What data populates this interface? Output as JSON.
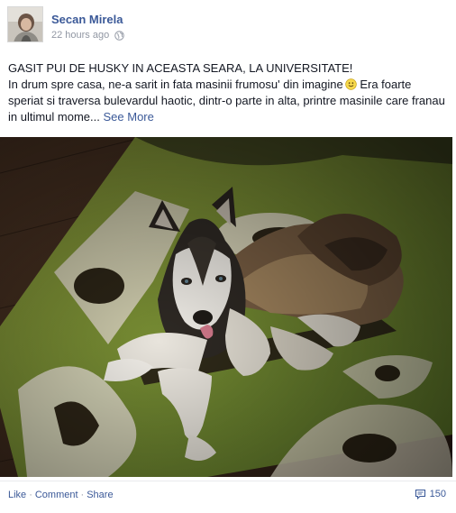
{
  "post": {
    "author": "Secan Mirela",
    "timestamp": "22 hours ago",
    "privacy_icon": "globe-icon",
    "message_title": "GASIT PUI DE HUSKY IN ACEASTA SEARA, LA UNIVERSITATE!",
    "message_body": "In drum spre casa, ne-a sarit in fata masinii frumosu' din imagine",
    "message_body_2": " Era foarte speriat si traversa bulevardul haotic, dintr-o parte in alta, printre masinile care franau in ultimul mome...",
    "see_more": "See More",
    "emoji": "smile-emoji-icon"
  },
  "actions": {
    "like": "Like",
    "comment": "Comment",
    "share": "Share",
    "separator": "·",
    "comment_count": "150"
  },
  "colors": {
    "link": "#3b5998",
    "meta": "#9197a3",
    "text": "#141823"
  }
}
